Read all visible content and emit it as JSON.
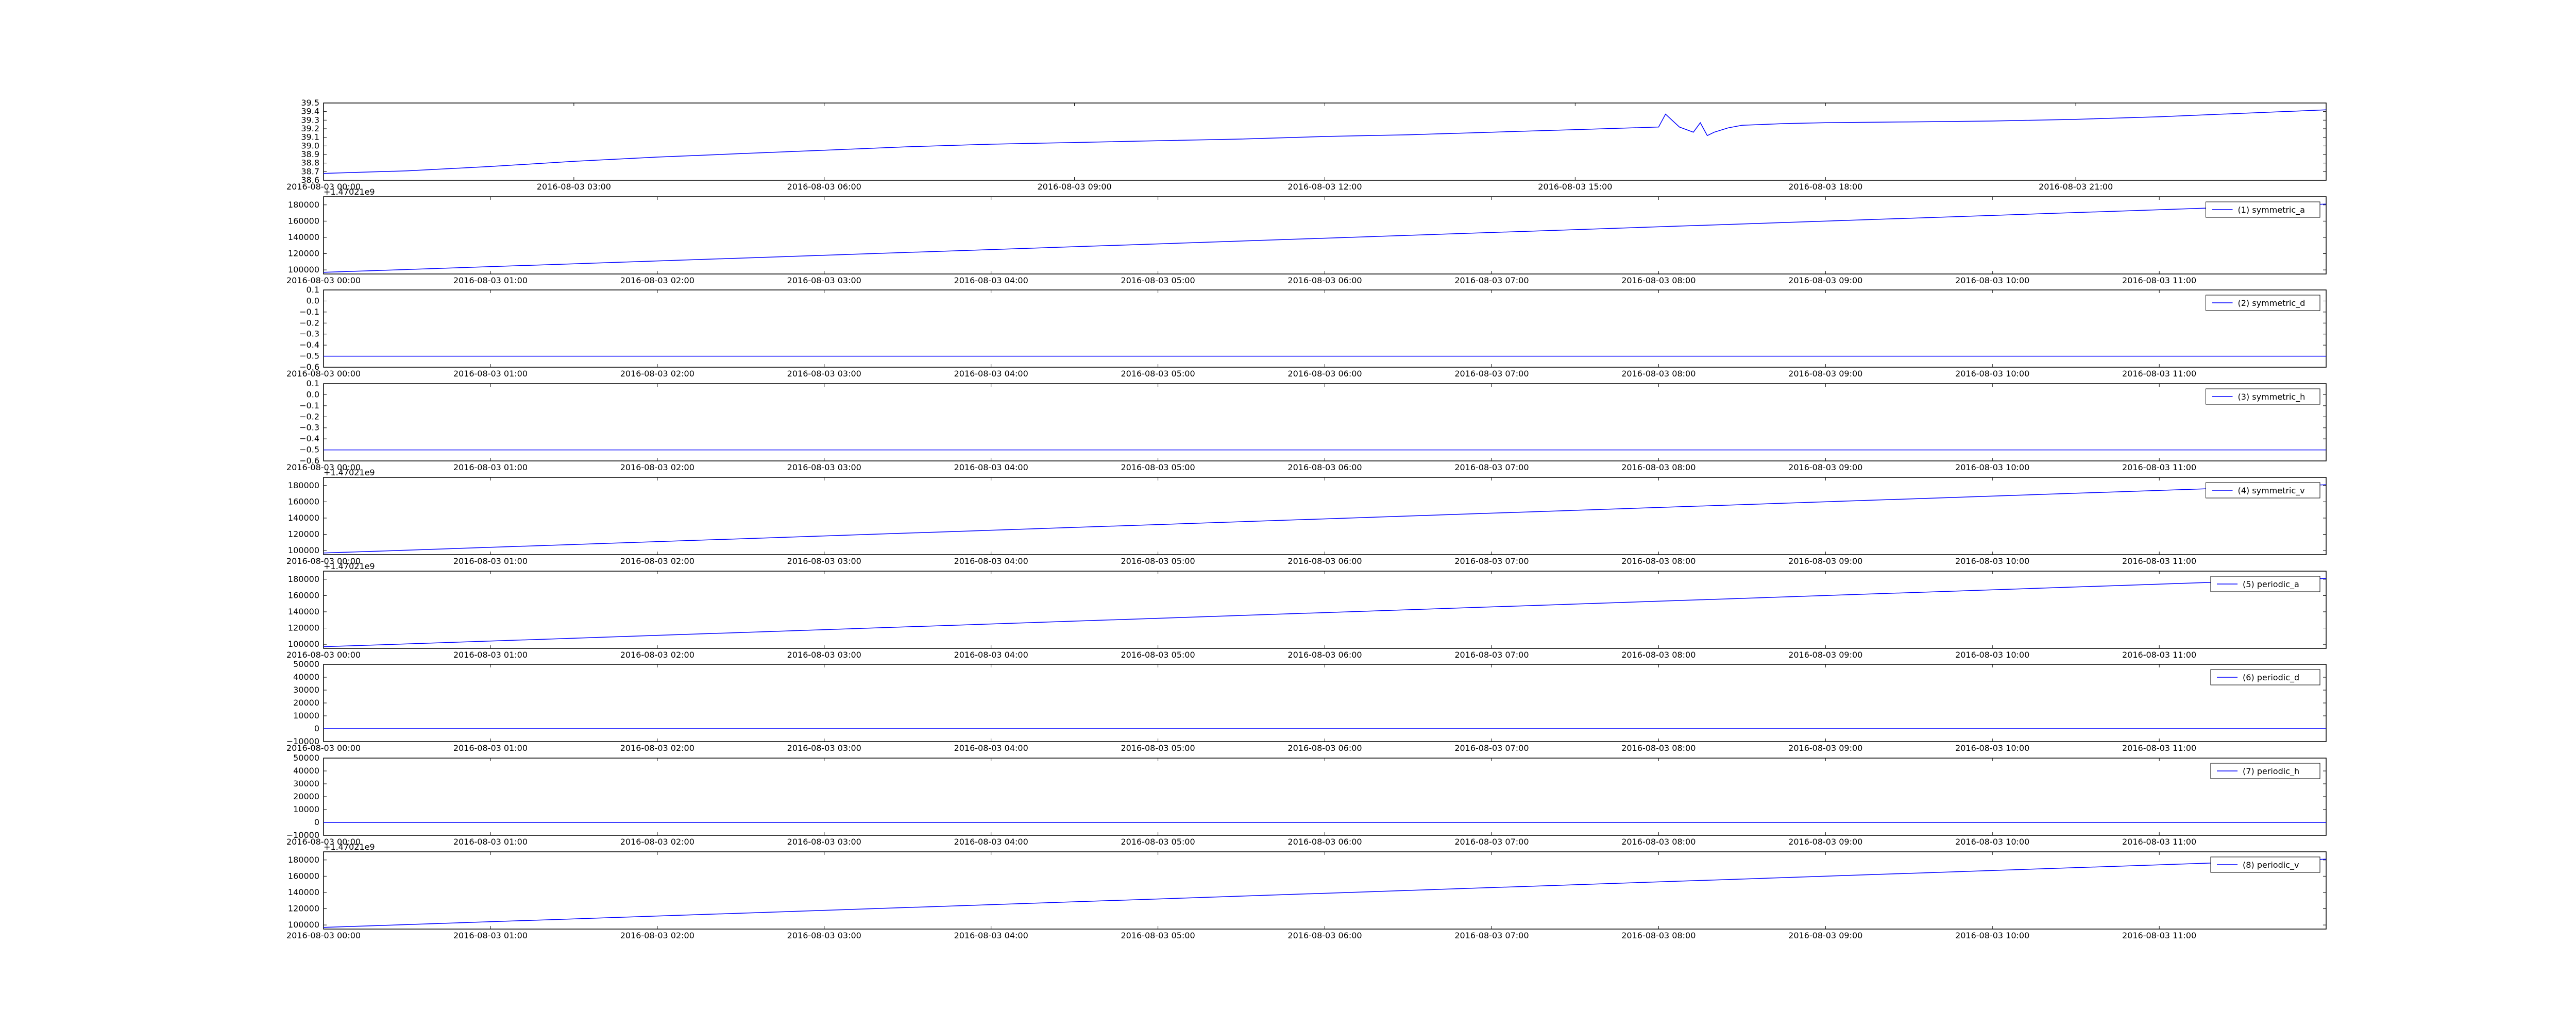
{
  "figure": {
    "line_color": "#0000ff",
    "frame_color": "#000000",
    "background": "#ffffff"
  },
  "chart_data": [
    {
      "type": "line",
      "title": "",
      "xlabel": "",
      "ylabel": "",
      "legend": null,
      "grid": false,
      "yticks": [
        "38.6",
        "38.7",
        "38.8",
        "38.9",
        "39.0",
        "39.1",
        "39.2",
        "39.3",
        "39.4",
        "39.5"
      ],
      "ylim": [
        38.6,
        39.5
      ],
      "offset_text": "",
      "xticks": [
        "2016-08-03 00:00",
        "2016-08-03 03:00",
        "2016-08-03 06:00",
        "2016-08-03 09:00",
        "2016-08-03 12:00",
        "2016-08-03 15:00",
        "2016-08-03 18:00",
        "2016-08-03 21:00"
      ],
      "xlim": [
        "2016-08-03 00:00",
        "2016-08-04 00:00"
      ],
      "series": [
        {
          "x": [
            "2016-08-03 00:00",
            "2016-08-03 01:00",
            "2016-08-03 02:00",
            "2016-08-03 03:00",
            "2016-08-03 04:00",
            "2016-08-03 05:00",
            "2016-08-03 06:00",
            "2016-08-03 07:00",
            "2016-08-03 08:00",
            "2016-08-03 09:00",
            "2016-08-03 10:00",
            "2016-08-03 11:00",
            "2016-08-03 12:00",
            "2016-08-03 13:00",
            "2016-08-03 14:00",
            "2016-08-03 15:00",
            "2016-08-03 16:00",
            "2016-08-03 16:05",
            "2016-08-03 16:15",
            "2016-08-03 16:25",
            "2016-08-03 16:30",
            "2016-08-03 16:35",
            "2016-08-03 16:40",
            "2016-08-03 16:50",
            "2016-08-03 17:00",
            "2016-08-03 17:30",
            "2016-08-03 18:00",
            "2016-08-03 19:00",
            "2016-08-03 20:00",
            "2016-08-03 21:00",
            "2016-08-03 22:00",
            "2016-08-03 23:00",
            "2016-08-04 00:00"
          ],
          "y": [
            38.68,
            38.71,
            38.76,
            38.82,
            38.87,
            38.91,
            38.95,
            38.99,
            39.02,
            39.04,
            39.06,
            39.08,
            39.11,
            39.13,
            39.16,
            39.19,
            39.22,
            39.37,
            39.22,
            39.16,
            39.27,
            39.12,
            39.16,
            39.21,
            39.24,
            39.26,
            39.27,
            39.28,
            39.29,
            39.31,
            39.34,
            39.38,
            39.42
          ]
        }
      ]
    },
    {
      "type": "line",
      "title": "",
      "xlabel": "",
      "ylabel": "",
      "grid": false,
      "legend": "upper right",
      "yticks": [
        "100000",
        "120000",
        "140000",
        "160000",
        "180000"
      ],
      "ylim": [
        95000,
        190000
      ],
      "offset_text": "+1.47021e9",
      "xticks": [
        "2016-08-03 00:00",
        "2016-08-03 01:00",
        "2016-08-03 02:00",
        "2016-08-03 03:00",
        "2016-08-03 04:00",
        "2016-08-03 05:00",
        "2016-08-03 06:00",
        "2016-08-03 07:00",
        "2016-08-03 08:00",
        "2016-08-03 09:00",
        "2016-08-03 10:00",
        "2016-08-03 11:00"
      ],
      "xlim": [
        "2016-08-03 00:00",
        "2016-08-03 12:00"
      ],
      "series": [
        {
          "name": "(1) symmetric_a",
          "x": [
            "2016-08-03 00:00",
            "2016-08-03 12:00"
          ],
          "y": [
            97000,
            181000
          ]
        }
      ]
    },
    {
      "type": "line",
      "title": "",
      "xlabel": "",
      "ylabel": "",
      "grid": false,
      "legend": "upper right",
      "yticks": [
        "−0.6",
        "−0.5",
        "−0.4",
        "−0.3",
        "−0.2",
        "−0.1",
        "0.0",
        "0.1"
      ],
      "ylim": [
        -0.6,
        0.1
      ],
      "offset_text": "",
      "xticks": [
        "2016-08-03 00:00",
        "2016-08-03 01:00",
        "2016-08-03 02:00",
        "2016-08-03 03:00",
        "2016-08-03 04:00",
        "2016-08-03 05:00",
        "2016-08-03 06:00",
        "2016-08-03 07:00",
        "2016-08-03 08:00",
        "2016-08-03 09:00",
        "2016-08-03 10:00",
        "2016-08-03 11:00"
      ],
      "xlim": [
        "2016-08-03 00:00",
        "2016-08-03 12:00"
      ],
      "series": [
        {
          "name": "(2) symmetric_d",
          "x": [
            "2016-08-03 00:00",
            "2016-08-03 12:00"
          ],
          "y": [
            -0.5,
            -0.5
          ]
        }
      ]
    },
    {
      "type": "line",
      "title": "",
      "xlabel": "",
      "ylabel": "",
      "grid": false,
      "legend": "upper right",
      "yticks": [
        "−0.6",
        "−0.5",
        "−0.4",
        "−0.3",
        "−0.2",
        "−0.1",
        "0.0",
        "0.1"
      ],
      "ylim": [
        -0.6,
        0.1
      ],
      "offset_text": "",
      "xticks": [
        "2016-08-03 00:00",
        "2016-08-03 01:00",
        "2016-08-03 02:00",
        "2016-08-03 03:00",
        "2016-08-03 04:00",
        "2016-08-03 05:00",
        "2016-08-03 06:00",
        "2016-08-03 07:00",
        "2016-08-03 08:00",
        "2016-08-03 09:00",
        "2016-08-03 10:00",
        "2016-08-03 11:00"
      ],
      "xlim": [
        "2016-08-03 00:00",
        "2016-08-03 12:00"
      ],
      "series": [
        {
          "name": "(3) symmetric_h",
          "x": [
            "2016-08-03 00:00",
            "2016-08-03 12:00"
          ],
          "y": [
            -0.5,
            -0.5
          ]
        }
      ]
    },
    {
      "type": "line",
      "title": "",
      "xlabel": "",
      "ylabel": "",
      "grid": false,
      "legend": "upper right",
      "yticks": [
        "100000",
        "120000",
        "140000",
        "160000",
        "180000"
      ],
      "ylim": [
        95000,
        190000
      ],
      "offset_text": "+1.47021e9",
      "xticks": [
        "2016-08-03 00:00",
        "2016-08-03 01:00",
        "2016-08-03 02:00",
        "2016-08-03 03:00",
        "2016-08-03 04:00",
        "2016-08-03 05:00",
        "2016-08-03 06:00",
        "2016-08-03 07:00",
        "2016-08-03 08:00",
        "2016-08-03 09:00",
        "2016-08-03 10:00",
        "2016-08-03 11:00"
      ],
      "xlim": [
        "2016-08-03 00:00",
        "2016-08-03 12:00"
      ],
      "series": [
        {
          "name": "(4) symmetric_v",
          "x": [
            "2016-08-03 00:00",
            "2016-08-03 12:00"
          ],
          "y": [
            97000,
            181000
          ]
        }
      ]
    },
    {
      "type": "line",
      "title": "",
      "xlabel": "",
      "ylabel": "",
      "grid": false,
      "legend": "upper right",
      "yticks": [
        "100000",
        "120000",
        "140000",
        "160000",
        "180000"
      ],
      "ylim": [
        95000,
        190000
      ],
      "offset_text": "+1.47021e9",
      "xticks": [
        "2016-08-03 00:00",
        "2016-08-03 01:00",
        "2016-08-03 02:00",
        "2016-08-03 03:00",
        "2016-08-03 04:00",
        "2016-08-03 05:00",
        "2016-08-03 06:00",
        "2016-08-03 07:00",
        "2016-08-03 08:00",
        "2016-08-03 09:00",
        "2016-08-03 10:00",
        "2016-08-03 11:00"
      ],
      "xlim": [
        "2016-08-03 00:00",
        "2016-08-03 12:00"
      ],
      "series": [
        {
          "name": "(5) periodic_a",
          "x": [
            "2016-08-03 00:00",
            "2016-08-03 12:00"
          ],
          "y": [
            97000,
            181000
          ]
        }
      ]
    },
    {
      "type": "line",
      "title": "",
      "xlabel": "",
      "ylabel": "",
      "grid": false,
      "legend": "upper right",
      "yticks": [
        "−10000",
        "0",
        "10000",
        "20000",
        "30000",
        "40000",
        "50000"
      ],
      "ylim": [
        -10000,
        50000
      ],
      "offset_text": "",
      "xticks": [
        "2016-08-03 00:00",
        "2016-08-03 01:00",
        "2016-08-03 02:00",
        "2016-08-03 03:00",
        "2016-08-03 04:00",
        "2016-08-03 05:00",
        "2016-08-03 06:00",
        "2016-08-03 07:00",
        "2016-08-03 08:00",
        "2016-08-03 09:00",
        "2016-08-03 10:00",
        "2016-08-03 11:00"
      ],
      "xlim": [
        "2016-08-03 00:00",
        "2016-08-03 12:00"
      ],
      "series": [
        {
          "name": "(6) periodic_d",
          "x": [
            "2016-08-03 00:00",
            "2016-08-03 12:00"
          ],
          "y": [
            0,
            0
          ]
        }
      ]
    },
    {
      "type": "line",
      "title": "",
      "xlabel": "",
      "ylabel": "",
      "grid": false,
      "legend": "upper right",
      "yticks": [
        "−10000",
        "0",
        "10000",
        "20000",
        "30000",
        "40000",
        "50000"
      ],
      "ylim": [
        -10000,
        50000
      ],
      "offset_text": "",
      "xticks": [
        "2016-08-03 00:00",
        "2016-08-03 01:00",
        "2016-08-03 02:00",
        "2016-08-03 03:00",
        "2016-08-03 04:00",
        "2016-08-03 05:00",
        "2016-08-03 06:00",
        "2016-08-03 07:00",
        "2016-08-03 08:00",
        "2016-08-03 09:00",
        "2016-08-03 10:00",
        "2016-08-03 11:00"
      ],
      "xlim": [
        "2016-08-03 00:00",
        "2016-08-03 12:00"
      ],
      "series": [
        {
          "name": "(7) periodic_h",
          "x": [
            "2016-08-03 00:00",
            "2016-08-03 12:00"
          ],
          "y": [
            0,
            0
          ]
        }
      ]
    },
    {
      "type": "line",
      "title": "",
      "xlabel": "",
      "ylabel": "",
      "grid": false,
      "legend": "upper right",
      "yticks": [
        "100000",
        "120000",
        "140000",
        "160000",
        "180000"
      ],
      "ylim": [
        95000,
        190000
      ],
      "offset_text": "+1.47021e9",
      "xticks": [
        "2016-08-03 00:00",
        "2016-08-03 01:00",
        "2016-08-03 02:00",
        "2016-08-03 03:00",
        "2016-08-03 04:00",
        "2016-08-03 05:00",
        "2016-08-03 06:00",
        "2016-08-03 07:00",
        "2016-08-03 08:00",
        "2016-08-03 09:00",
        "2016-08-03 10:00",
        "2016-08-03 11:00"
      ],
      "xlim": [
        "2016-08-03 00:00",
        "2016-08-03 12:00"
      ],
      "series": [
        {
          "name": "(8) periodic_v",
          "x": [
            "2016-08-03 00:00",
            "2016-08-03 12:00"
          ],
          "y": [
            97000,
            181000
          ]
        }
      ]
    }
  ]
}
